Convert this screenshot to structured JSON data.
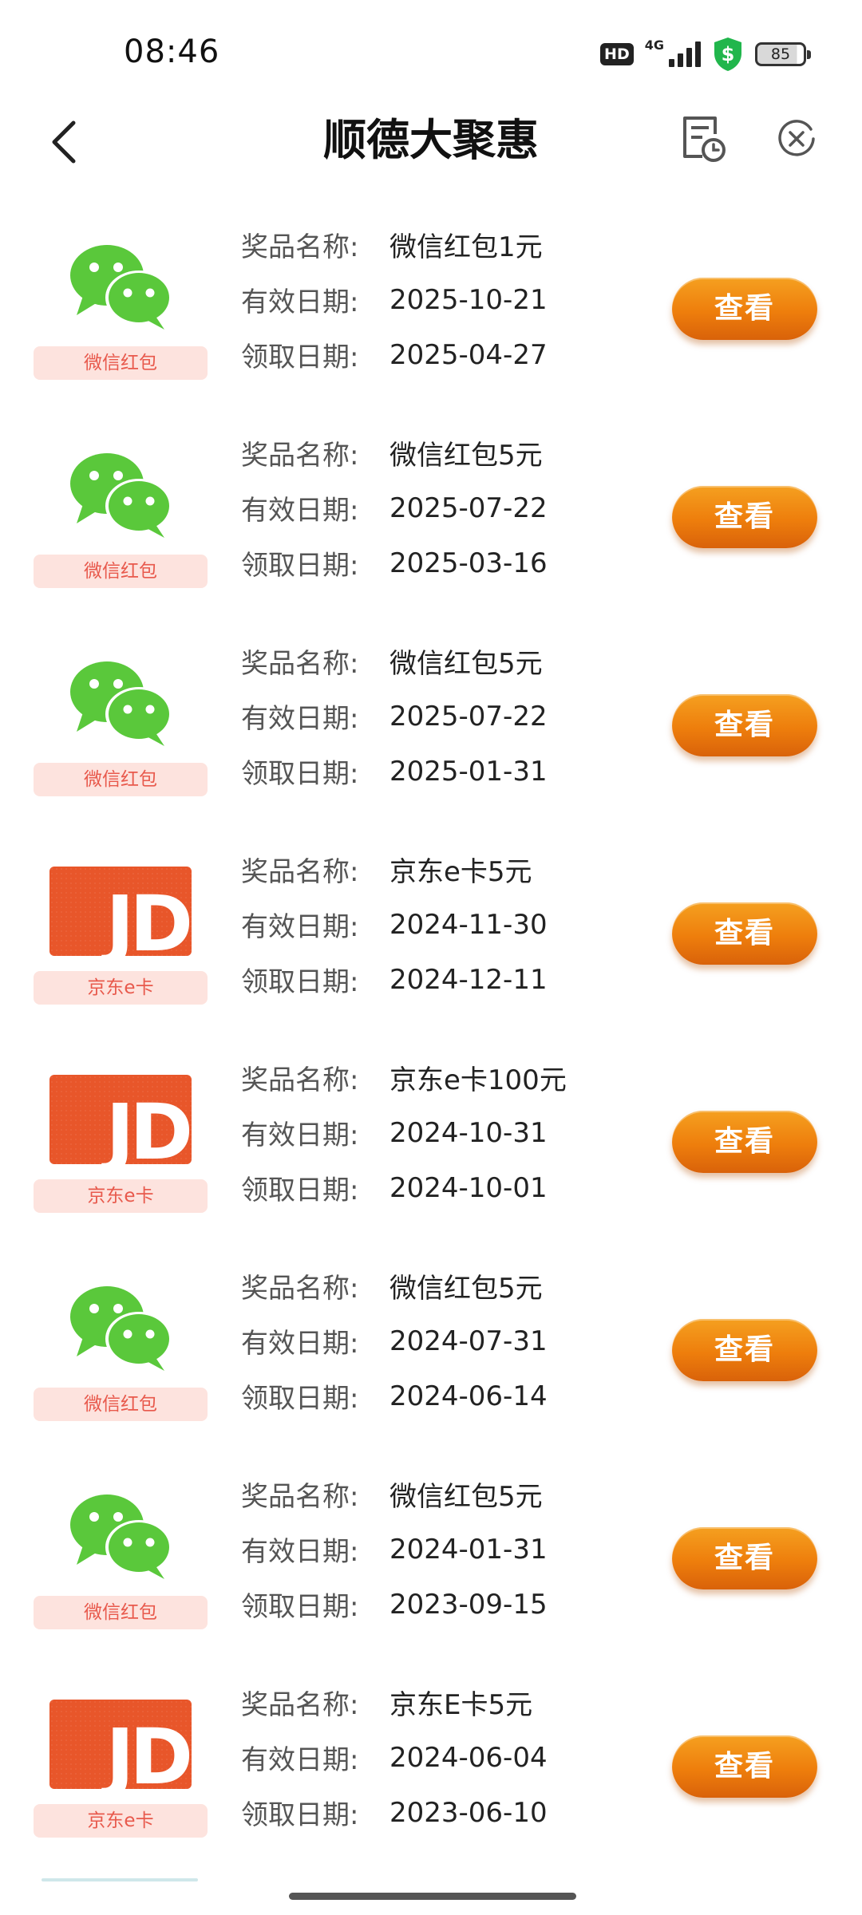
{
  "status": {
    "time": "08:46",
    "hd": "HD",
    "network": "4G",
    "battery": "85"
  },
  "nav": {
    "title": "顺德大聚惠"
  },
  "labels": {
    "name_key": "奖品名称:",
    "valid_key": "有效日期:",
    "received_key": "领取日期:",
    "view_button": "查看"
  },
  "prizes": [
    {
      "type": "wechat",
      "tag": "微信红包",
      "name": "微信红包1元",
      "valid": "2025-10-21",
      "received": "2025-04-27"
    },
    {
      "type": "wechat",
      "tag": "微信红包",
      "name": "微信红包5元",
      "valid": "2025-07-22",
      "received": "2025-03-16"
    },
    {
      "type": "wechat",
      "tag": "微信红包",
      "name": "微信红包5元",
      "valid": "2025-07-22",
      "received": "2025-01-31"
    },
    {
      "type": "jd",
      "tag": "京东e卡",
      "name": "京东e卡5元",
      "valid": "2024-11-30",
      "received": "2024-12-11"
    },
    {
      "type": "jd",
      "tag": "京东e卡",
      "name": "京东e卡100元",
      "valid": "2024-10-31",
      "received": "2024-10-01"
    },
    {
      "type": "wechat",
      "tag": "微信红包",
      "name": "微信红包5元",
      "valid": "2024-07-31",
      "received": "2024-06-14"
    },
    {
      "type": "wechat",
      "tag": "微信红包",
      "name": "微信红包5元",
      "valid": "2024-01-31",
      "received": "2023-09-15"
    },
    {
      "type": "jd",
      "tag": "京东e卡",
      "name": "京东E卡5元",
      "valid": "2024-06-04",
      "received": "2023-06-10"
    }
  ],
  "jd_card_text": "JD",
  "colors": {
    "wechat_green": "#5ac83b",
    "jd_orange": "#e8562a",
    "button_orange": "#ee7e0c",
    "tag_bg": "#fde3de",
    "tag_text": "#e8594c"
  }
}
